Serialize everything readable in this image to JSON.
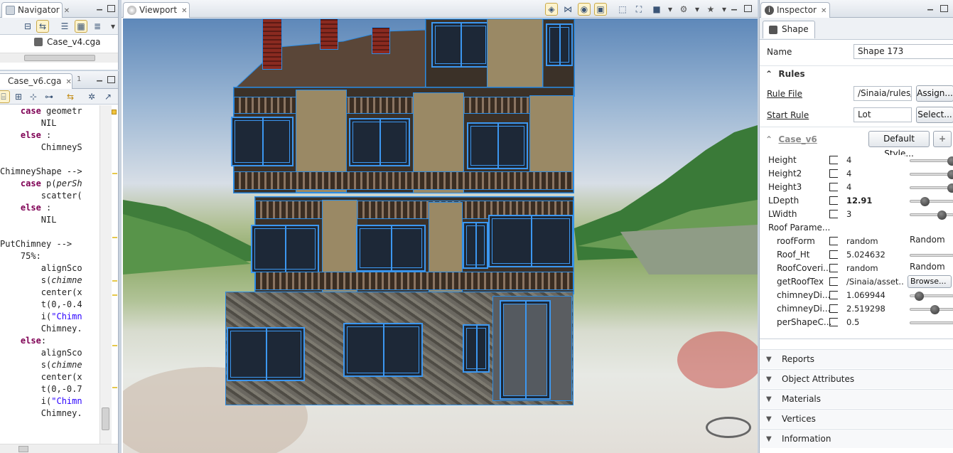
{
  "navigator": {
    "tab": "Navigator",
    "file": "Case_v4.cga"
  },
  "editor": {
    "tab": "Case_v6.cga",
    "tab2": "1",
    "lines": [
      "    case geometr",
      "        NIL",
      "    else :",
      "        ChimneyS",
      "",
      "ChimneyShape -->",
      "    case p(perSh",
      "        scatter(",
      "    else :",
      "        NIL",
      "",
      "PutChimney -->",
      "    75%:",
      "        alignSco",
      "        s(chimne",
      "        center(x",
      "        t(0,-0.4",
      "        i(\"Chimn",
      "        Chimney.",
      "    else:",
      "        alignSco",
      "        s(chimne",
      "        center(x",
      "        t(0,-0.7",
      "        i(\"Chimn",
      "        Chimney."
    ]
  },
  "viewport": {
    "tab": "Viewport"
  },
  "inspector": {
    "tab": "Inspector",
    "subtab": "Shape",
    "name_label": "Name",
    "name_value": "Shape 173",
    "rules_title": "Rules",
    "rule_file_label": "Rule File",
    "rule_file_value": "/Sinaia/rules/(",
    "assign_btn": "Assign...",
    "start_rule_label": "Start Rule",
    "start_rule_value": "Lot",
    "select_btn": "Select...",
    "case_title": "Case_v6",
    "default_style_btn": "Default Style...",
    "plus_btn": "+",
    "attrs": [
      {
        "label": "Height",
        "value": "4",
        "knob": 1.0
      },
      {
        "label": "Height2",
        "value": "4",
        "knob": 1.0
      },
      {
        "label": "Height3",
        "value": "4",
        "knob": 1.0
      },
      {
        "label": "LDepth",
        "value": "12.91",
        "knob": 0.35
      },
      {
        "label": "LWidth",
        "value": "3",
        "knob": 0.75
      }
    ],
    "group_label": "Roof Parame...",
    "roof_attrs": [
      {
        "label": "roofForm",
        "value": "random",
        "extra": "Random",
        "kind": "text"
      },
      {
        "label": "Roof_Ht",
        "value": "5.024632",
        "kind": "slider",
        "knob": -1
      },
      {
        "label": "RoofCoveri...",
        "value": "random",
        "extra": "Random",
        "kind": "text"
      },
      {
        "label": "getRoofTex",
        "value": "/Sinaia/asset...",
        "extra": "Browse...",
        "kind": "button"
      },
      {
        "label": "chimneyDi...",
        "value": "1.069944",
        "kind": "slider",
        "knob": 0.2
      },
      {
        "label": "chimneyDi...",
        "value": "2.519298",
        "kind": "slider",
        "knob": 0.58
      },
      {
        "label": "perShapeC...",
        "value": "0.5",
        "kind": "slider",
        "knob": -1
      }
    ],
    "sections": [
      "Reports",
      "Object Attributes",
      "Materials",
      "Vertices",
      "Information"
    ]
  }
}
